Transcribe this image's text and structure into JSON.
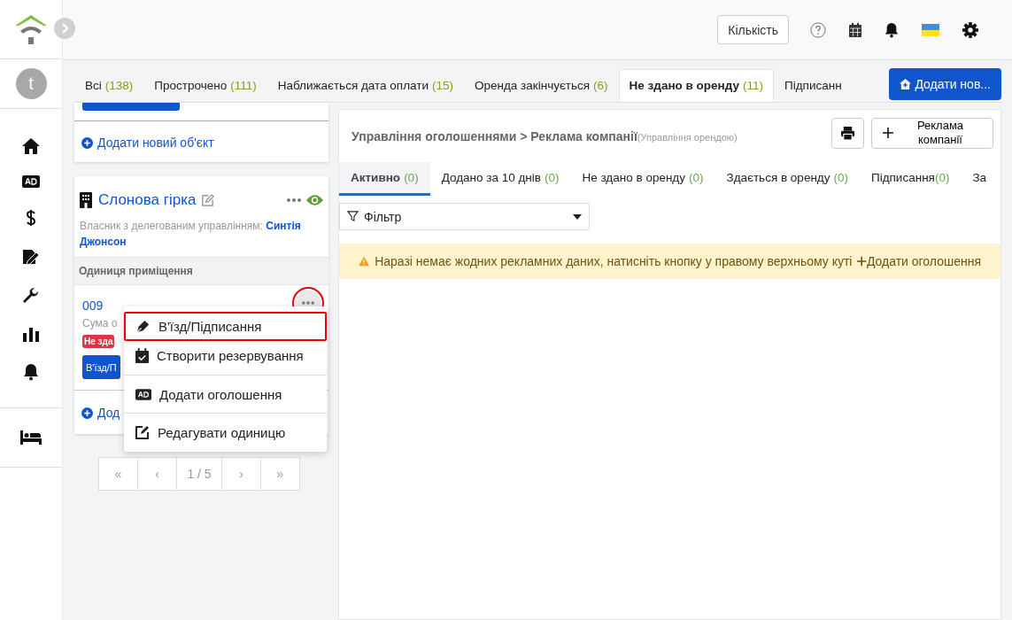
{
  "header": {
    "quantity_button": "Кількість"
  },
  "sidebar": {
    "avatar": "t"
  },
  "top_tabs": [
    {
      "label": "Всі",
      "count": "(138)",
      "selected": false
    },
    {
      "label": "Прострочено",
      "count": "(111)",
      "selected": false
    },
    {
      "label": "Наближається дата оплати",
      "count": "(15)",
      "selected": false
    },
    {
      "label": "Оренда закінчується",
      "count": "(6)",
      "selected": false
    },
    {
      "label": "Не здано в оренду",
      "count": "(11)",
      "selected": true
    },
    {
      "label": "Підписанн",
      "selected": false
    }
  ],
  "add_new_button": "Додати нов...",
  "properties": {
    "add_object_link": "Додати новий об'єкт",
    "card": {
      "name": "Слонова гірка",
      "owner_label": "Власник з делегованим управлінням:",
      "owner_name": "Синтія Джонсон",
      "visible": true,
      "section_title": "Одиниця приміщення",
      "unit": {
        "number": "009",
        "sum_label": "Сума о",
        "status_badge": "Не зда",
        "action_button": "В'їзд/П",
        "more_highlighted": true
      },
      "add_unit_link": "Дод"
    }
  },
  "pagination": [
    "«",
    "‹",
    "1 / 5",
    "›",
    "»"
  ],
  "context_menu": [
    {
      "label": "В'їзд/Підписання",
      "kind": "sign",
      "highlighted": true,
      "divider_before": false
    },
    {
      "label": "Створити резервування",
      "kind": "calendar",
      "highlighted": false,
      "divider_before": false
    },
    {
      "label": "Додати оголошення",
      "kind": "ad",
      "highlighted": false,
      "divider_before": true
    },
    {
      "label": "Редагувати одиницю",
      "kind": "edit",
      "highlighted": false,
      "divider_before": true
    }
  ],
  "panel": {
    "breadcrumb": "Управління оголошеннями > Реклама компанії",
    "breadcrumb_note": "(Управління орендою)",
    "add_button": "Реклама компанії",
    "tabs": [
      {
        "label": "Активно",
        "count": "(0)",
        "selected": true
      },
      {
        "label": "Додано за 10 днів",
        "count": "(0)",
        "selected": false
      },
      {
        "label": "Не здано в оренду",
        "count": "(0)",
        "selected": false
      },
      {
        "label": "Здається в оренду",
        "count": "(0)",
        "selected": false
      },
      {
        "label": "Підписання",
        "count": "(0)",
        "selected": false
      },
      {
        "label": "За",
        "selected": false
      }
    ],
    "filter": {
      "value": "Фільтр"
    },
    "alert": "Наразі немає жодних рекламних даних, натисніть кнопку у правому верхньому куті",
    "alert_link": "Додати оголошення"
  }
}
